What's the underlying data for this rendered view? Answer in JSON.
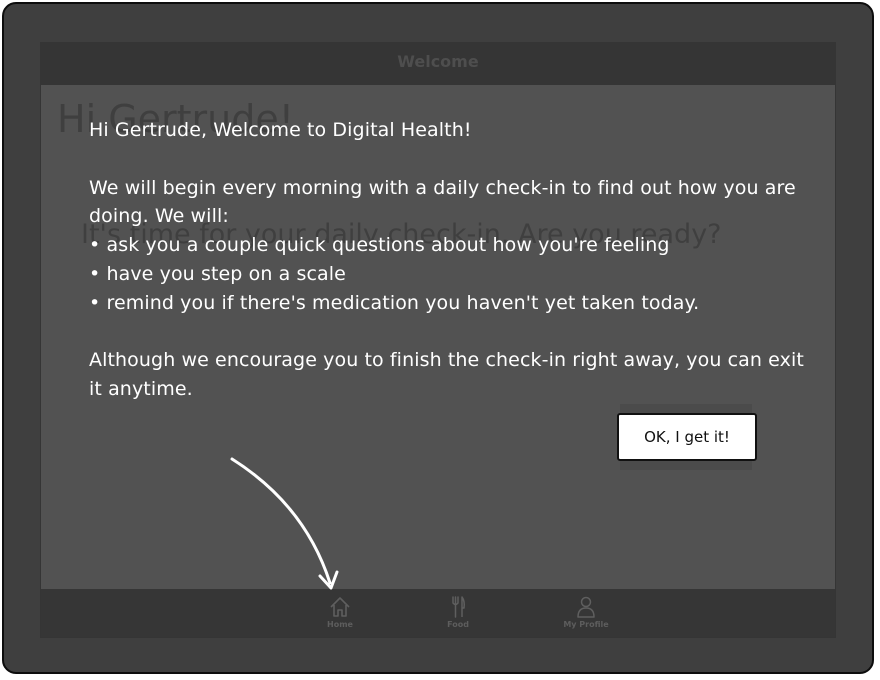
{
  "screen": {
    "title": "Welcome",
    "background_greeting": "Hi Gertrude!",
    "background_question": "It's time for your daily check-in. Are you ready?"
  },
  "dialog": {
    "heading": "Hi Gertrude, Welcome to Digital Health!",
    "intro": "We will begin every morning with a daily check-in to find out how you are doing. We will:",
    "bullets": [
      "• ask you a couple quick questions about how you're feeling",
      "• have you step on a scale",
      "• remind you if there's medication you haven't yet taken today."
    ],
    "outro": "Although we encourage you to finish the check-in right away, you can exit it anytime.",
    "ok_label": "OK, I get it!"
  },
  "tabbar": {
    "tabs": [
      {
        "label": "Home",
        "icon": "home-icon"
      },
      {
        "label": "Food",
        "icon": "fork-knife-icon"
      },
      {
        "label": "My Profile",
        "icon": "person-icon"
      }
    ]
  },
  "colors": {
    "frame": "#3f3f3f",
    "screen": "#5c5c5c",
    "bars": "#353535",
    "text": "#ffffff"
  }
}
